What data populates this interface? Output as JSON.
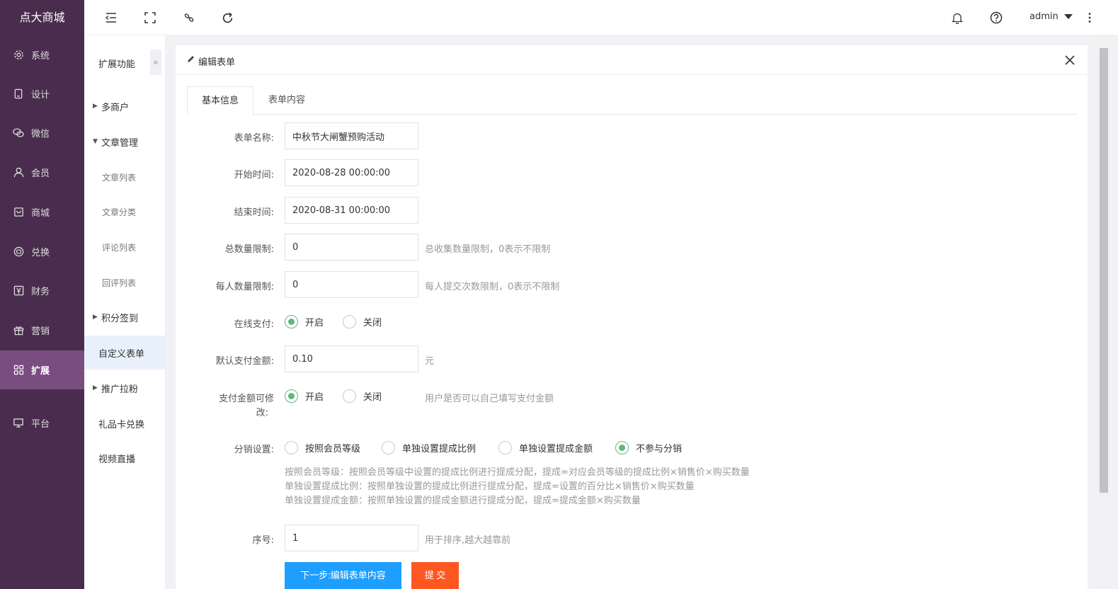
{
  "app": {
    "logo": "点大商城",
    "admin": "admin"
  },
  "sidebar": {
    "items": [
      {
        "label": "系统",
        "icon": "gear-icon"
      },
      {
        "label": "设计",
        "icon": "tablet-icon"
      },
      {
        "label": "微信",
        "icon": "wechat-icon"
      },
      {
        "label": "会员",
        "icon": "user-icon"
      },
      {
        "label": "商城",
        "icon": "shop-icon"
      },
      {
        "label": "兑换",
        "icon": "coin-icon"
      },
      {
        "label": "财务",
        "icon": "yen-icon"
      },
      {
        "label": "营销",
        "icon": "gift-icon"
      },
      {
        "label": "扩展",
        "icon": "grid-icon"
      },
      {
        "label": "平台",
        "icon": "monitor-icon"
      }
    ],
    "active": "扩展"
  },
  "subnav": {
    "title": "扩展功能",
    "items": [
      {
        "label": "多商户"
      },
      {
        "label": "文章管理"
      },
      {
        "label": "文章列表"
      },
      {
        "label": "文章分类"
      },
      {
        "label": "评论列表"
      },
      {
        "label": "回评列表"
      },
      {
        "label": "积分签到"
      },
      {
        "label": "自定义表单"
      },
      {
        "label": "推广拉粉"
      },
      {
        "label": "礼品卡兑换"
      },
      {
        "label": "视频直播"
      }
    ]
  },
  "panel": {
    "title": "编辑表单",
    "tabs": [
      {
        "label": "基本信息"
      },
      {
        "label": "表单内容"
      }
    ]
  },
  "form": {
    "name": {
      "label": "表单名称:",
      "value": "中秋节大闸蟹预购活动"
    },
    "start": {
      "label": "开始时间:",
      "value": "2020-08-28 00:00:00"
    },
    "end": {
      "label": "结束时间:",
      "value": "2020-08-31 00:00:00"
    },
    "total": {
      "label": "总数量限制:",
      "value": "0",
      "hint": "总收集数量限制，0表示不限制"
    },
    "per": {
      "label": "每人数量限制:",
      "value": "0",
      "hint": "每人提交次数限制，0表示不限制"
    },
    "pay": {
      "label": "在线支付:",
      "on": "开启",
      "off": "关闭"
    },
    "amount": {
      "label": "默认支付金额:",
      "value": "0.10",
      "unit": "元"
    },
    "editable": {
      "label1": "支付金额可修",
      "label2": "改:",
      "on": "开启",
      "off": "关闭",
      "hint": "用户是否可以自己填写支付金额"
    },
    "distribution": {
      "label": "分销设置:",
      "options": [
        "按照会员等级",
        "单独设置提成比例",
        "单独设置提成金额",
        "不参与分销"
      ],
      "selected": "不参与分销",
      "notes": [
        "按照会员等级：按照会员等级中设置的提成比例进行提成分配，提成=对应会员等级的提成比例×销售价×购买数量",
        "单独设置提成比例：按照单独设置的提成比例进行提成分配，提成=设置的百分比×销售价×购买数量",
        "单独设置提成金额：按照单独设置的提成金额进行提成分配，提成=提成金额×购买数量"
      ]
    },
    "order": {
      "label": "序号:",
      "value": "1",
      "hint": "用于排序,越大越靠前"
    },
    "next_button": "下一步:编辑表单内容",
    "submit_button": "提 交"
  },
  "colors": {
    "sidebar": "#4a2d4e",
    "sidebar_active": "#7a4d80",
    "primary": "#1e9fff",
    "submit": "#ff5722",
    "radio": "#5fb878"
  }
}
